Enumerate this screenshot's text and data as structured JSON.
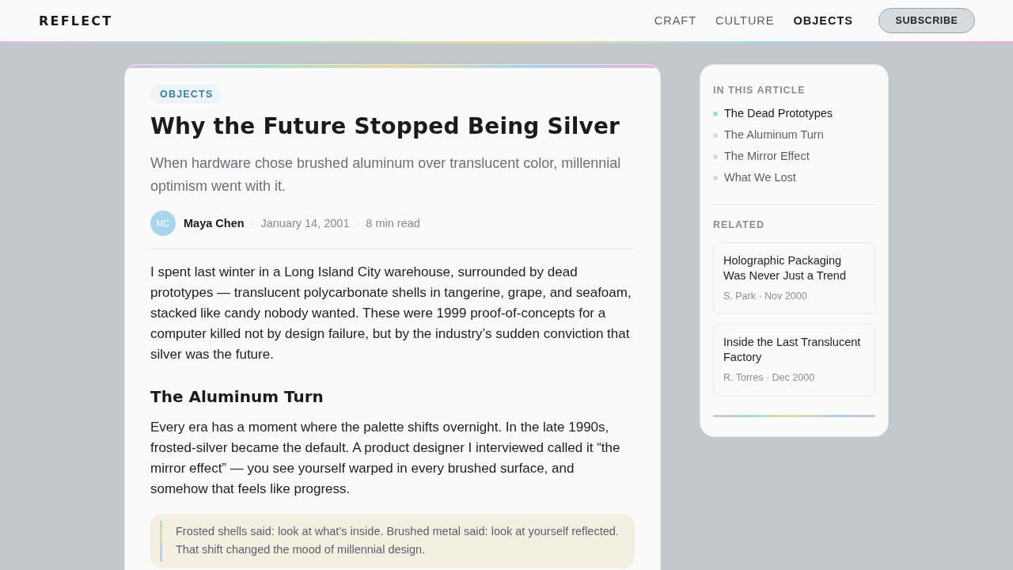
{
  "header": {
    "logo": "REFLECT",
    "nav": [
      {
        "label": "CRAFT",
        "selected": false
      },
      {
        "label": "CULTURE",
        "selected": false
      },
      {
        "label": "OBJECTS",
        "selected": true
      }
    ],
    "subscribe_button": "SUBSCRIBE"
  },
  "article": {
    "category": "OBJECTS",
    "title": "Why the Future Stopped Being Silver",
    "subtitle": "When hardware chose brushed aluminum over translucent color, millennial optimism went with it.",
    "byline": {
      "initials": "MC",
      "parts": [
        {
          "kind": "author",
          "text": "Maya Chen"
        },
        {
          "kind": "separator",
          "text": "·"
        },
        {
          "kind": "date",
          "text": "January 14, 2001"
        },
        {
          "kind": "separator",
          "text": "·"
        },
        {
          "kind": "read_time",
          "text": "8 min read"
        }
      ]
    },
    "body": [
      {
        "kind": "paragraph",
        "text": "I spent last winter in a Long Island City warehouse, surrounded by dead prototypes — translucent polycarbonate shells in tangerine, grape, and seafoam, stacked like candy nobody wanted. These were 1999 proof-of-concepts for a computer killed not by design failure, but by the industry’s sudden conviction that silver was the future."
      },
      {
        "kind": "heading",
        "text": "The Aluminum Turn"
      },
      {
        "kind": "paragraph",
        "text": "Every era has a moment where the palette shifts overnight. In the late 1990s, frosted-silver became the default. A product designer I interviewed called it “the mirror effect” — you see yourself warped in every brushed surface, and somehow that feels like progress."
      },
      {
        "kind": "pullquote",
        "text": "Frosted shells said: look at what’s inside. Brushed metal said: look at yourself reflected. That shift changed the mood of millennial design."
      }
    ]
  },
  "sidebar": {
    "toc_heading": "IN THIS ARTICLE",
    "toc": [
      {
        "label": "The Dead Prototypes",
        "selected": true
      },
      {
        "label": "The Aluminum Turn",
        "selected": false
      },
      {
        "label": "The Mirror Effect",
        "selected": false
      },
      {
        "label": "What We Lost",
        "selected": false
      }
    ],
    "related_heading": "RELATED",
    "related": [
      {
        "title": "Holographic Packaging Was Never Just a Trend",
        "meta": "S. Park · Nov 2000"
      },
      {
        "title": "Inside the Last Translucent Factory",
        "meta": "R. Torres · Dec 2000"
      }
    ]
  }
}
